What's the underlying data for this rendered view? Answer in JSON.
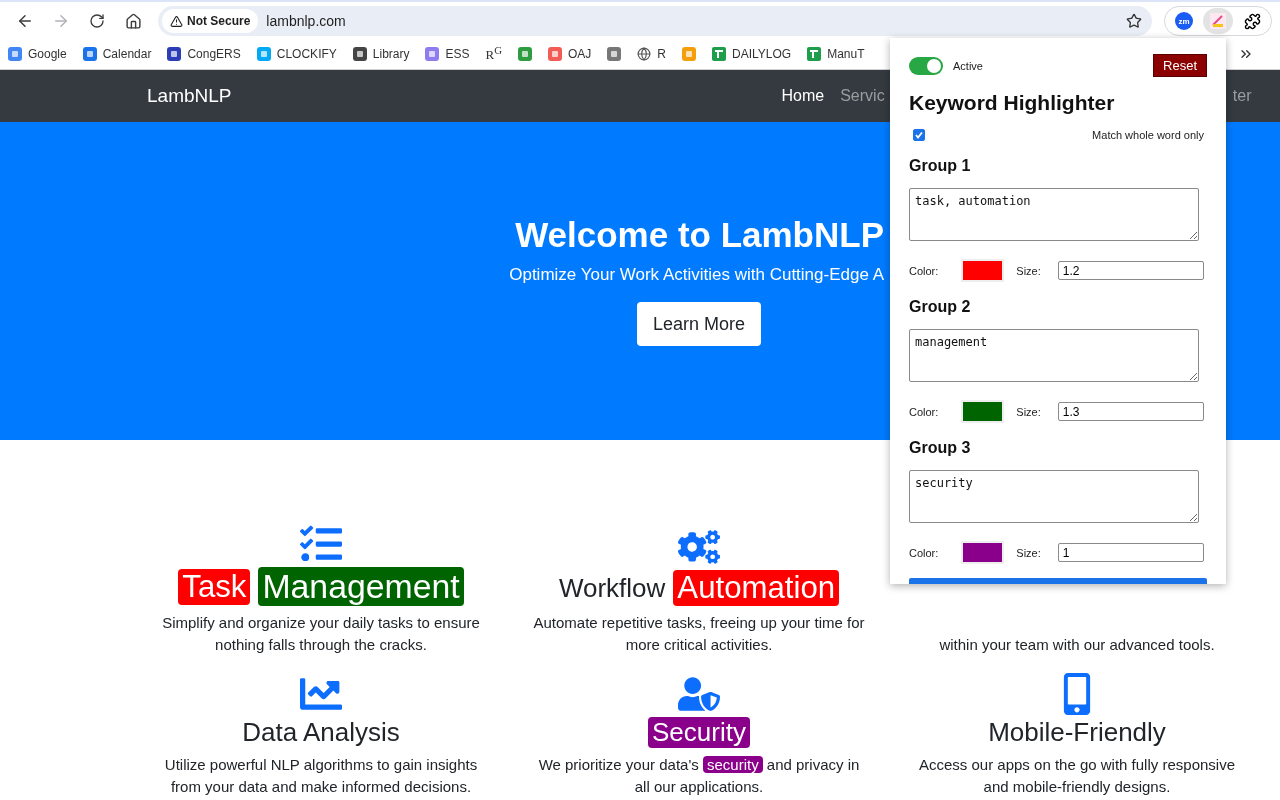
{
  "browser": {
    "security_chip": "Not Secure",
    "url": "lambnlp.com",
    "extensions": [
      {
        "kind": "badge",
        "text": "zm",
        "selected": false
      },
      {
        "kind": "highlighter",
        "selected": true
      }
    ],
    "bookmarks": [
      {
        "kind": "link",
        "label": "Google"
      },
      {
        "kind": "link",
        "label": "Calendar"
      },
      {
        "kind": "link",
        "label": "CongERS"
      },
      {
        "kind": "link",
        "label": "CLOCKIFY"
      },
      {
        "kind": "link",
        "label": "Library"
      },
      {
        "kind": "link",
        "label": "ESS"
      },
      {
        "kind": "glyph",
        "glyph": "R$^{G}$"
      },
      {
        "kind": "icon"
      },
      {
        "kind": "link",
        "label": "OAJ"
      },
      {
        "kind": "icon"
      },
      {
        "kind": "link",
        "label": "R"
      },
      {
        "kind": "icon"
      },
      {
        "kind": "link",
        "label": "DAILYLOG"
      },
      {
        "kind": "link",
        "label": "ManuT"
      }
    ]
  },
  "site": {
    "brand": "LambNLP",
    "nav": [
      {
        "label": "Home",
        "selected": true
      },
      {
        "label": "Servic",
        "selected": false
      },
      {
        "label": "ter",
        "selected": false
      }
    ],
    "hero": {
      "title": "Welcome to LambNLP",
      "subtitle": "Optimize Your Work Activities with Cutting-Edge A",
      "button": "Learn More"
    },
    "features": [
      {
        "title": [
          {
            "text": "Task",
            "kind": "group1"
          },
          {
            "text": "Management",
            "kind": "group2"
          }
        ],
        "description": [
          {
            "text": "Simplify and organize your daily tasks to ensure nothing falls through the cracks."
          }
        ]
      },
      {
        "title": [
          {
            "text": "Workflow"
          },
          {
            "text": "Automation",
            "kind": "group1"
          }
        ],
        "description": [
          {
            "text": "Automate repetitive tasks, freeing up your time for more critical activities."
          }
        ]
      },
      {
        "description": [
          {
            "text": "within your team with our advanced tools."
          }
        ]
      },
      {
        "title": [
          {
            "text": "Data Analysis"
          }
        ],
        "description": [
          {
            "text": "Utilize powerful NLP algorithms to gain insights from your data and make informed decisions."
          }
        ]
      },
      {
        "title": [
          {
            "text": "Security",
            "kind": "group3"
          }
        ],
        "description": [
          {
            "text": "We prioritize your data's "
          },
          {
            "text": "security",
            "kind": "group3"
          },
          {
            "text": " and privacy in all our applications."
          }
        ]
      },
      {
        "title": [
          {
            "text": "Mobile-Friendly"
          }
        ],
        "description": [
          {
            "text": "Access our apps on the go with fully responsive and mobile-friendly designs."
          }
        ]
      }
    ]
  },
  "popup": {
    "active": true,
    "active_label": "Active",
    "reset": "Reset",
    "title": "Keyword Highlighter",
    "whole_word": true,
    "whole_word_label": "Match whole word only",
    "groups": [
      {
        "heading": "Group 1",
        "keywords": "task, automation",
        "color_label": "Color:",
        "color": "#ff0000",
        "size_label": "Size:",
        "size": "1.2"
      },
      {
        "heading": "Group 2",
        "keywords": "management",
        "color_label": "Color:",
        "color": "#006400",
        "size_label": "Size:",
        "size": "1.3"
      },
      {
        "heading": "Group 3",
        "keywords": "security",
        "color_label": "Color:",
        "color": "#8b008b",
        "size_label": "Size:",
        "size": "1"
      }
    ]
  }
}
